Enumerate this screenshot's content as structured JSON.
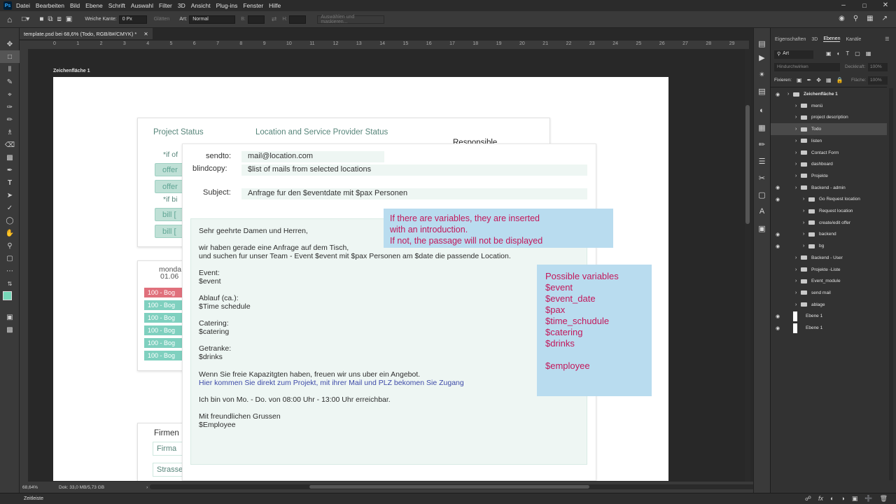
{
  "menu": {
    "logo": "Ps",
    "items": [
      "Datei",
      "Bearbeiten",
      "Bild",
      "Ebene",
      "Schrift",
      "Auswahl",
      "Filter",
      "3D",
      "Ansicht",
      "Plug-ins",
      "Fenster",
      "Hilfe"
    ]
  },
  "options": {
    "feather_label": "Weiche Kante:",
    "feather_value": "0 Px",
    "smooth": "Glätten",
    "style_label": "Art:",
    "style_value": "Normal",
    "width_label": "B:",
    "height_label": "H:",
    "select_mask": "Auswählen und maskieren..."
  },
  "document": {
    "tab_title": "template.psd bei 68,6% (Todo, RGB/8#/CMYK) *",
    "artboard_label": "Zeichenfläche 1",
    "ruler_ticks": [
      "0",
      "1",
      "2",
      "3",
      "4",
      "5",
      "6",
      "7",
      "8",
      "9",
      "10",
      "11",
      "12",
      "13",
      "14",
      "15",
      "16",
      "17",
      "18",
      "19",
      "20",
      "21",
      "22",
      "23",
      "24",
      "25",
      "26",
      "27",
      "28",
      "29"
    ]
  },
  "design": {
    "project_status": "Project Status",
    "location_status": "Location and Service Provider Status",
    "responsible": "Responsible",
    "if_offer": "*if of",
    "offer1": "offer",
    "offer2": "offer",
    "if_bill": "*if bi",
    "bill1": "bill [",
    "bill2": "bill [",
    "monday": "monda",
    "date": "01.06",
    "pills": [
      "100 - Bog",
      "100 - Bog",
      "100 - Bog",
      "100 - Bog",
      "100 - Bog",
      "100 - Bog"
    ],
    "firmen": "Firmen",
    "firma": "Firma",
    "strasse": "Strasse"
  },
  "email": {
    "sendto_label": "sendto:",
    "sendto_value": "mail@location.com",
    "bcc_label": "blindcopy:",
    "bcc_value": "$list of mails from selected locations",
    "subject_label": "Subject:",
    "subject_value": "Anfrage fur den $eventdate mit $pax Personen",
    "body": {
      "greeting": "Sehr geehrte Damen und Herren,",
      "line1": "wir haben gerade eine Anfrage auf dem Tisch,",
      "line2": "und suchen fur unser Team - Event $event mit $pax Personen am $date die passende Location.",
      "event_label": "Event:",
      "event_var": "$event",
      "ablauf_label": "Ablauf (ca.):",
      "ablauf_var": "$Time schedule",
      "catering_label": "Catering:",
      "catering_var": "$catering",
      "drinks_label": "Getranke:",
      "drinks_var": "$drinks",
      "capacity": "Wenn Sie freie Kapazitgten haben, freuen wir uns uber ein Angebot.",
      "link": "Hier kommen Sie direkt zum Projekt, mit ihrer Mail und PLZ bekomen Sie Zugang",
      "hours": "Ich bin von Mo. - Do. von 08:00 Uhr - 13:00 Uhr erreichbar.",
      "closing": "Mit freundlichen Grussen",
      "employee": "$Employee"
    }
  },
  "notes": {
    "variables_info": [
      "If there are variables, they are inserted",
      "with an introduction.",
      "If not, the passage will not be displayed"
    ],
    "possible_title": "Possible variables",
    "possible_vars": [
      "$event",
      "$event_date",
      "$pax",
      "$time_schudule",
      "$catering",
      "$drinks",
      "",
      "$employee"
    ]
  },
  "panel": {
    "tabs": [
      "Eigenschaften",
      "3D",
      "Ebenen",
      "Kanäle"
    ],
    "filter": "Art",
    "blend": "Hindurchwirken",
    "opacity_label": "Deckkraft:",
    "opacity_value": "100%",
    "lock_label": "Fixieren:",
    "fill_label": "Fläche:",
    "fill_value": "100%",
    "layers": [
      {
        "name": "Zeichenfläche 1",
        "eye": true
      },
      {
        "name": "menü",
        "eye": false
      },
      {
        "name": "project description",
        "eye": false
      },
      {
        "name": "Todo",
        "eye": false
      },
      {
        "name": "listen",
        "eye": false
      },
      {
        "name": "Contact Form",
        "eye": false
      },
      {
        "name": "dashboard",
        "eye": false
      },
      {
        "name": "Projekte",
        "eye": false
      },
      {
        "name": "Backend - admin",
        "eye": true
      },
      {
        "name": "Go Request location",
        "eye": true
      },
      {
        "name": "Request location",
        "eye": false
      },
      {
        "name": "create/edit offer",
        "eye": false
      },
      {
        "name": "backend",
        "eye": true
      },
      {
        "name": "bg",
        "eye": true
      },
      {
        "name": "Backend - User",
        "eye": false
      },
      {
        "name": "Projekte -Liste",
        "eye": false
      },
      {
        "name": "Event_module",
        "eye": false
      },
      {
        "name": "send mail",
        "eye": false
      },
      {
        "name": "ablage",
        "eye": false
      },
      {
        "name": "Ebene 1",
        "eye": true
      },
      {
        "name": "Ebene 1",
        "eye": true
      }
    ]
  },
  "status": {
    "zoom": "68,64%",
    "doc": "Dok: 33,0 MB/5,73 GB",
    "timeline": "Zeitleiste"
  },
  "colors": {
    "teal_text": "#57857a",
    "note_bg": "#b9dcef",
    "note_text": "#c2185b",
    "mail_bg": "#eef6f3",
    "link": "#3d4aa8"
  }
}
